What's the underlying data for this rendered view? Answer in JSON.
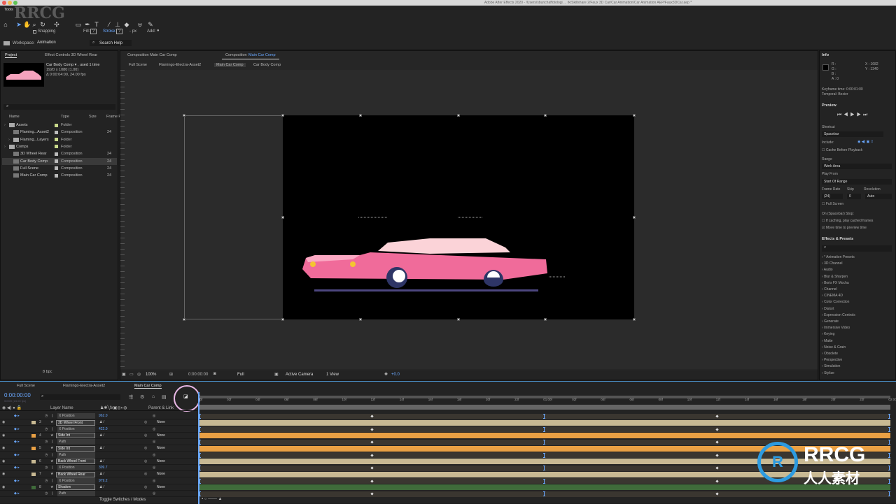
{
  "window": {
    "title": "Adobe After Effects 2020 - /Users/sbunchaffotologi ... rk/Skillshare 2/Faux 3D Car/Car Animation/Car Animation AEP/Faux3DCar.aep *"
  },
  "tools": {
    "panel_label": "Tools",
    "snapping": "Snapping",
    "fill": "Fill:",
    "fill_val": "?",
    "stroke": "Stroke:",
    "stroke_val": "?",
    "px": "- px",
    "add": "Add:"
  },
  "workspace": {
    "label": "Workspace:",
    "value": "Animation",
    "search": "Search Help"
  },
  "project": {
    "tab": "Project",
    "tab2": "Effect Controls 3D Wheel Rear",
    "item_name": "Car Body Comp ▾ , used 1 time",
    "item_res": "1920 x 1080 (1.00)",
    "item_dur": "Δ 0:00:04:00, 24.00 fps",
    "headers": {
      "name": "Name",
      "type": "Type",
      "size": "Size",
      "frame": "Frame R"
    },
    "items": [
      {
        "name": "Assets",
        "type": "Folder",
        "fps": "",
        "color": "#c8d98a",
        "indent": 0,
        "folder": true
      },
      {
        "name": "Flaming...Asset2",
        "type": "Composition",
        "fps": "24",
        "color": "#bbbbbb",
        "indent": 1,
        "folder": false
      },
      {
        "name": "Flaming...Layers",
        "type": "Folder",
        "fps": "",
        "color": "#c8d98a",
        "indent": 1,
        "folder": true
      },
      {
        "name": "Comps",
        "type": "Folder",
        "fps": "",
        "color": "#c8d98a",
        "indent": 0,
        "folder": true
      },
      {
        "name": "3D Wheel Rear",
        "type": "Composition",
        "fps": "24",
        "color": "#bbbbbb",
        "indent": 1,
        "folder": false
      },
      {
        "name": "Car Body Comp",
        "type": "Composition",
        "fps": "24",
        "color": "#bbbbbb",
        "indent": 1,
        "folder": false,
        "selected": true
      },
      {
        "name": "Full Scene",
        "type": "Composition",
        "fps": "24",
        "color": "#bbbbbb",
        "indent": 1,
        "folder": false
      },
      {
        "name": "Main Car Comp",
        "type": "Composition",
        "fps": "24",
        "color": "#bbbbbb",
        "indent": 1,
        "folder": false
      }
    ],
    "footer": "8 bpc"
  },
  "comp": {
    "tab1": "Composition Main Car Comp",
    "tab2_prefix": "Composition",
    "tab2_name": "Main Car Comp",
    "crumbs": [
      "Full Scene",
      "Flamingo-Electra-Asset2",
      "Main Car Comp",
      "Car Body Comp"
    ],
    "zoom": "100%",
    "time": "0:00:00:00",
    "resolution": "Full",
    "camera": "Active Camera",
    "views": "1 View",
    "exposure": "+0.0"
  },
  "info": {
    "title": "Info",
    "r": "R :",
    "g": "G :",
    "b": "B :",
    "a": "A : 0",
    "x": "X : 1682",
    "y": "Y : 1340",
    "kf_time": "Keyframe time: 0:00:01:00",
    "temporal": "Temporal: Bezier"
  },
  "preview": {
    "title": "Preview",
    "shortcut_label": "Shortcut",
    "shortcut": "Spacebar",
    "include": "Include:",
    "cache": "Cache Before Playback",
    "range_label": "Range",
    "range": "Work Area",
    "playfrom_label": "Play From",
    "playfrom": "Start Of Range",
    "fr_label": "Frame Rate",
    "skip_label": "Skip",
    "res_label": "Resolution",
    "fr": "(24)",
    "skip": "0",
    "res": "Auto",
    "fullscreen": "Full Screen",
    "onstop": "On (Spacebar) Stop:",
    "ifcaching": "If caching, play cached frames",
    "movetime": "Move time to preview time",
    "movetime_checked": true
  },
  "effects": {
    "title": "Effects & Presets",
    "items": [
      "* Animation Presets",
      "3D Channel",
      "Audio",
      "Blur & Sharpen",
      "Boris FX Mocha",
      "Channel",
      "CINEMA 4D",
      "Color Correction",
      "Distort",
      "Expression Controls",
      "Generate",
      "Immersive Video",
      "Keying",
      "Matte",
      "Noise & Grain",
      "Obsolete",
      "Perspective",
      "Simulation",
      "Stylize"
    ]
  },
  "timeline": {
    "tabs": [
      "Full Scene",
      "Flamingo-Electra-Asset2",
      "Main Car Comp"
    ],
    "timecode": "0:00:00:00",
    "timecode_sub": "00000 (24.00 fps)",
    "col_layer": "Layer Name",
    "col_parent": "Parent & Link",
    "ticks": [
      "00f",
      "02f",
      "04f",
      "06f",
      "08f",
      "10f",
      "12f",
      "14f",
      "16f",
      "18f",
      "20f",
      "22f",
      "01:00f",
      "02f",
      "04f",
      "06f",
      "08f",
      "10f",
      "12f",
      "14f",
      "16f",
      "18f",
      "20f",
      "22f",
      "02:00f"
    ],
    "rows": [
      {
        "kind": "prop",
        "name": "X Position",
        "value": "962.0"
      },
      {
        "kind": "layer",
        "num": "3",
        "name": "3D Wheel Front",
        "label": "#c8b993",
        "parent": "None",
        "bar": "#c8b993"
      },
      {
        "kind": "prop",
        "name": "X Position",
        "value": "422.0"
      },
      {
        "kind": "layer",
        "num": "4",
        "name": "Side Int",
        "label": "#e9a044",
        "parent": "None",
        "bar": "#e9a044"
      },
      {
        "kind": "prop",
        "name": "Path",
        "value": ""
      },
      {
        "kind": "layer",
        "num": "5",
        "name": "Side Int",
        "label": "#e9a044",
        "parent": "None",
        "bar": "#e9a044"
      },
      {
        "kind": "prop",
        "name": "Path",
        "value": ""
      },
      {
        "kind": "layer",
        "num": "6",
        "name": "Back Wheel Front",
        "label": "#c8b993",
        "parent": "None",
        "bar": "#c8b993"
      },
      {
        "kind": "prop",
        "name": "X Position",
        "value": "309.7"
      },
      {
        "kind": "layer",
        "num": "7",
        "name": "Back Wheel Rear",
        "label": "#c8b993",
        "parent": "None",
        "bar": "#c8b993"
      },
      {
        "kind": "prop",
        "name": "X Position",
        "value": "979.2"
      },
      {
        "kind": "layer",
        "num": "8",
        "name": "Shadow",
        "label": "#3f6b3a",
        "parent": "None",
        "bar": "#3f6b3a"
      },
      {
        "kind": "prop",
        "name": "Path",
        "value": ""
      }
    ],
    "footer": "Toggle Switches / Modes"
  },
  "watermark": {
    "text": "RRCG",
    "cn": "人人素材"
  },
  "colors": {
    "accent": "#4a90c8",
    "car_body": "#f06b9a",
    "car_roof": "#fbd3d8",
    "wheel": "#2e3566"
  }
}
